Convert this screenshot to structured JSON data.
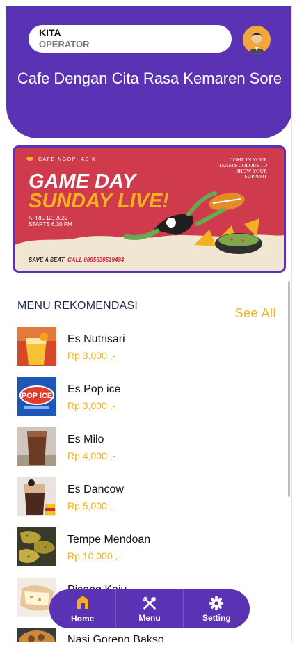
{
  "header": {
    "user_name": "KITA",
    "user_role": "OPERATOR",
    "title": "Cafe Dengan Cita Rasa Kemaren Sore"
  },
  "banner": {
    "brand": "CAFE NGOPI ASIK",
    "headline_1": "GAME DAY",
    "headline_2": "SUNDAY LIVE!",
    "date": "APRIL 12, 2022",
    "time": "STARTS 6.30 PM",
    "invite_1": "COME IN YOUR",
    "invite_2": "TEAM'S COLORS TO",
    "invite_3": "SHOW YOUR",
    "invite_4": "SUPPORT",
    "save_seat": "SAVE A SEAT",
    "call": "CALL 0895630519484"
  },
  "section": {
    "title": "MENU REKOMENDASI",
    "see_all": "See All"
  },
  "menu": [
    {
      "name": "Es Nutrisari",
      "price": "Rp 3,000 ,-"
    },
    {
      "name": "Es Pop ice",
      "price": "Rp 3,000 ,-"
    },
    {
      "name": "Es Milo",
      "price": "Rp 4,000 ,-"
    },
    {
      "name": "Es Dancow",
      "price": "Rp 5,000 ,-"
    },
    {
      "name": "Tempe Mendoan",
      "price": "Rp 10,000 ,-"
    },
    {
      "name": "Pisang Keju",
      "price": ""
    },
    {
      "name": "Nasi Goreng Bakso",
      "price": ""
    }
  ],
  "nav": {
    "home": "Home",
    "menu": "Menu",
    "setting": "Setting"
  },
  "colors": {
    "primary": "#5a33b4",
    "accent": "#f2b21e"
  }
}
